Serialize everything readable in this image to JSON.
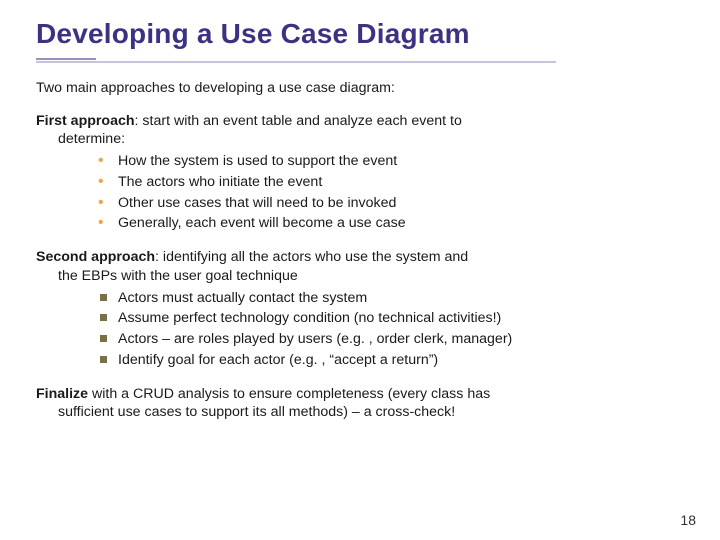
{
  "title": "Developing a Use Case Diagram",
  "intro": "Two main approaches to developing a use case diagram:",
  "approach1": {
    "label": "First approach",
    "text": ": start with an event table and analyze each event to",
    "text_line2": "determine:",
    "bullets": [
      "How the system is used to support the event",
      "The actors who initiate the event",
      "Other use cases that will need to be invoked",
      "Generally, each event will become a use case"
    ]
  },
  "approach2": {
    "label": "Second approach",
    "text": ": identifying all the actors who use the system and",
    "text_line2": "the EBPs with the user goal technique",
    "bullets": [
      "Actors must actually contact the system",
      "Assume perfect technology condition (no technical activities!)",
      "Actors – are roles played by users (e.g. , order clerk, manager)",
      "Identify goal for each actor (e.g. , “accept a return”)"
    ]
  },
  "finalize": {
    "label": "Finalize",
    "text": " with a CRUD analysis to ensure completeness (every class has",
    "text_line2": "sufficient use cases to support its all methods) – a cross-check!"
  },
  "page": "18"
}
